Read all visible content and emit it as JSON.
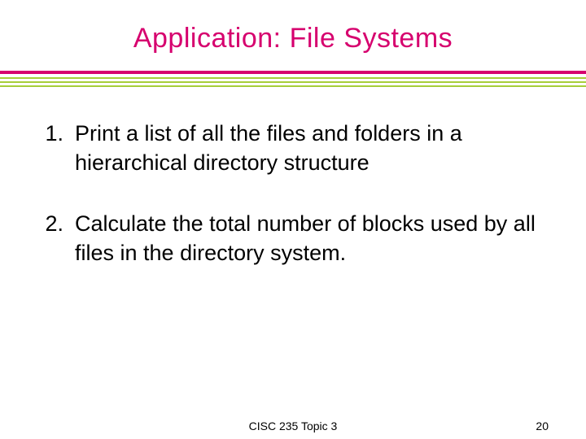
{
  "title": "Application:  File Systems",
  "items": [
    {
      "num": "1.",
      "text": "Print a list of all the files and folders in a hierarchical directory structure"
    },
    {
      "num": "2.",
      "text": "Calculate the total number of blocks used by all files in the directory system."
    }
  ],
  "footer": {
    "center": "CISC 235 Topic 3",
    "page": "20"
  }
}
